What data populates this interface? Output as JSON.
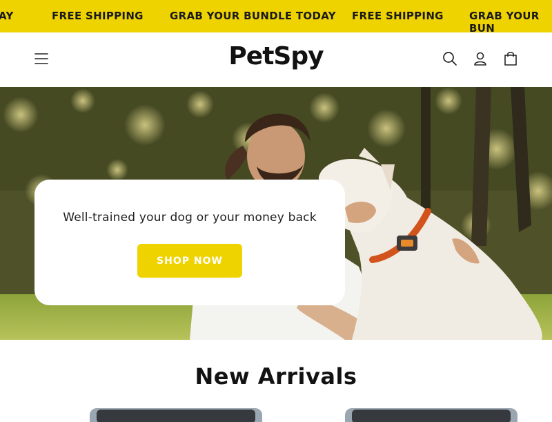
{
  "announcement": {
    "items": [
      "AY",
      "FREE SHIPPING",
      "GRAB YOUR BUNDLE TODAY",
      "FREE SHIPPING",
      "GRAB YOUR BUN"
    ]
  },
  "header": {
    "logo": "PetSpy",
    "icons": [
      "menu-icon",
      "search-icon",
      "account-icon",
      "cart-icon"
    ]
  },
  "hero": {
    "headline": "Well-trained your dog or your money back",
    "cta_label": "SHOP NOW"
  },
  "section": {
    "title": "New Arrivals"
  },
  "colors": {
    "accent": "#efd300",
    "text": "#121212",
    "card": "#ffffff"
  }
}
